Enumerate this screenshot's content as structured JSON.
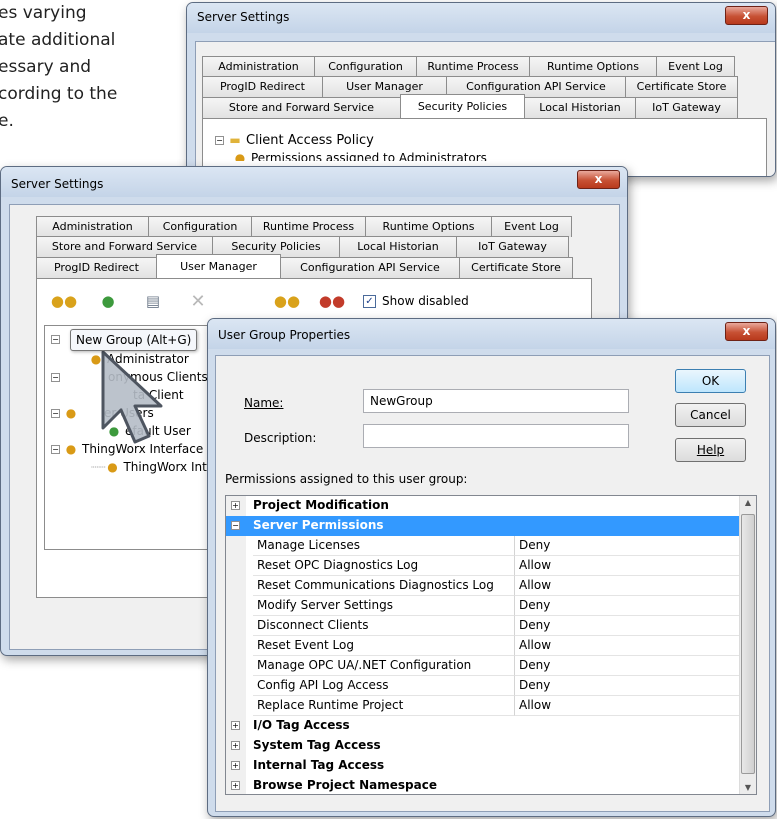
{
  "background_text": [
    "es varying",
    "ate additional",
    "essary and",
    "cording to the",
    "e."
  ],
  "win1": {
    "title": "Server Settings",
    "close": "x",
    "tabs_row1": [
      "Administration",
      "Configuration",
      "Runtime Process",
      "Runtime Options",
      "Event Log"
    ],
    "tabs_row2": [
      "ProgID Redirect",
      "User Manager",
      "Configuration API Service",
      "Certificate Store"
    ],
    "tabs_row3": [
      "Store and Forward Service",
      "Security Policies",
      "Local Historian",
      "IoT Gateway"
    ],
    "tree_item": "Client Access Policy",
    "tree_item_cut": "Permissions assigned to Administrators"
  },
  "win2": {
    "title": "Server Settings",
    "close": "x",
    "tabs_row1": [
      "Administration",
      "Configuration",
      "Runtime Process",
      "Runtime Options",
      "Event Log"
    ],
    "tabs_row2": [
      "Store and Forward Service",
      "Security Policies",
      "Local Historian",
      "IoT Gateway"
    ],
    "tabs_row3": [
      "ProgID Redirect",
      "User Manager",
      "Configuration API Service",
      "Certificate Store"
    ],
    "show_disabled": "Show disabled",
    "tooltip": "New Group (Alt+G)",
    "tree": [
      "Administrator",
      "onymous Clients",
      "ta Client",
      "er Users",
      "efault User",
      "ThingWorx Interface",
      "ThingWorx Inter"
    ]
  },
  "dialog": {
    "title": "User Group Properties",
    "close": "x",
    "name_label": "Name:",
    "name_value": "NewGroup",
    "description_label": "Description:",
    "description_value": "",
    "ok": "OK",
    "cancel": "Cancel",
    "help": "Help",
    "permissions_label": "Permissions assigned to this user group:",
    "categories": {
      "project_modification": "Project Modification",
      "server_permissions": "Server Permissions",
      "io_tag_access": "I/O Tag Access",
      "system_tag_access": "System Tag Access",
      "internal_tag_access": "Internal Tag Access",
      "browse_project_namespace": "Browse Project Namespace"
    },
    "server_permissions_rows": [
      {
        "name": "Manage Licenses",
        "value": "Deny"
      },
      {
        "name": "Reset OPC Diagnostics Log",
        "value": "Allow"
      },
      {
        "name": "Reset Communications Diagnostics Log",
        "value": "Allow"
      },
      {
        "name": "Modify Server Settings",
        "value": "Deny"
      },
      {
        "name": "Disconnect Clients",
        "value": "Deny"
      },
      {
        "name": "Reset Event Log",
        "value": "Allow"
      },
      {
        "name": "Manage OPC UA/.NET Configuration",
        "value": "Deny"
      },
      {
        "name": "Config API Log Access",
        "value": "Deny"
      },
      {
        "name": "Replace Runtime Project",
        "value": "Allow"
      }
    ]
  }
}
